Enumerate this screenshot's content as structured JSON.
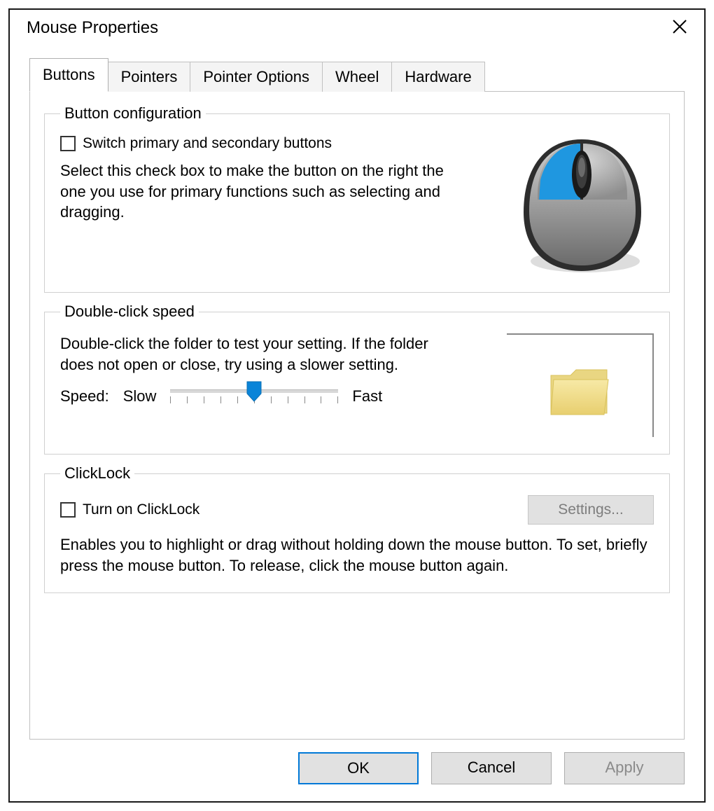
{
  "window": {
    "title": "Mouse Properties"
  },
  "tabs": [
    {
      "label": "Buttons",
      "active": true
    },
    {
      "label": "Pointers",
      "active": false
    },
    {
      "label": "Pointer Options",
      "active": false
    },
    {
      "label": "Wheel",
      "active": false
    },
    {
      "label": "Hardware",
      "active": false
    }
  ],
  "button_config": {
    "legend": "Button configuration",
    "checkbox_label": "Switch primary and secondary buttons",
    "checkbox_checked": false,
    "description": "Select this check box to make the button on the right the one you use for primary functions such as selecting and dragging.",
    "primary_button_highlight": "left",
    "highlight_color": "#1F97E0"
  },
  "double_click": {
    "legend": "Double-click speed",
    "description": "Double-click the folder to test your setting. If the folder does not open or close, try using a slower setting.",
    "speed_label": "Speed:",
    "slow_label": "Slow",
    "fast_label": "Fast",
    "slider_min": 0,
    "slider_max": 10,
    "slider_value": 5
  },
  "clicklock": {
    "legend": "ClickLock",
    "checkbox_label": "Turn on ClickLock",
    "checkbox_checked": false,
    "settings_button": "Settings...",
    "settings_enabled": false,
    "description": "Enables you to highlight or drag without holding down the mouse button. To set, briefly press the mouse button. To release, click the mouse button again."
  },
  "buttons": {
    "ok": "OK",
    "cancel": "Cancel",
    "apply": "Apply",
    "apply_enabled": false
  }
}
